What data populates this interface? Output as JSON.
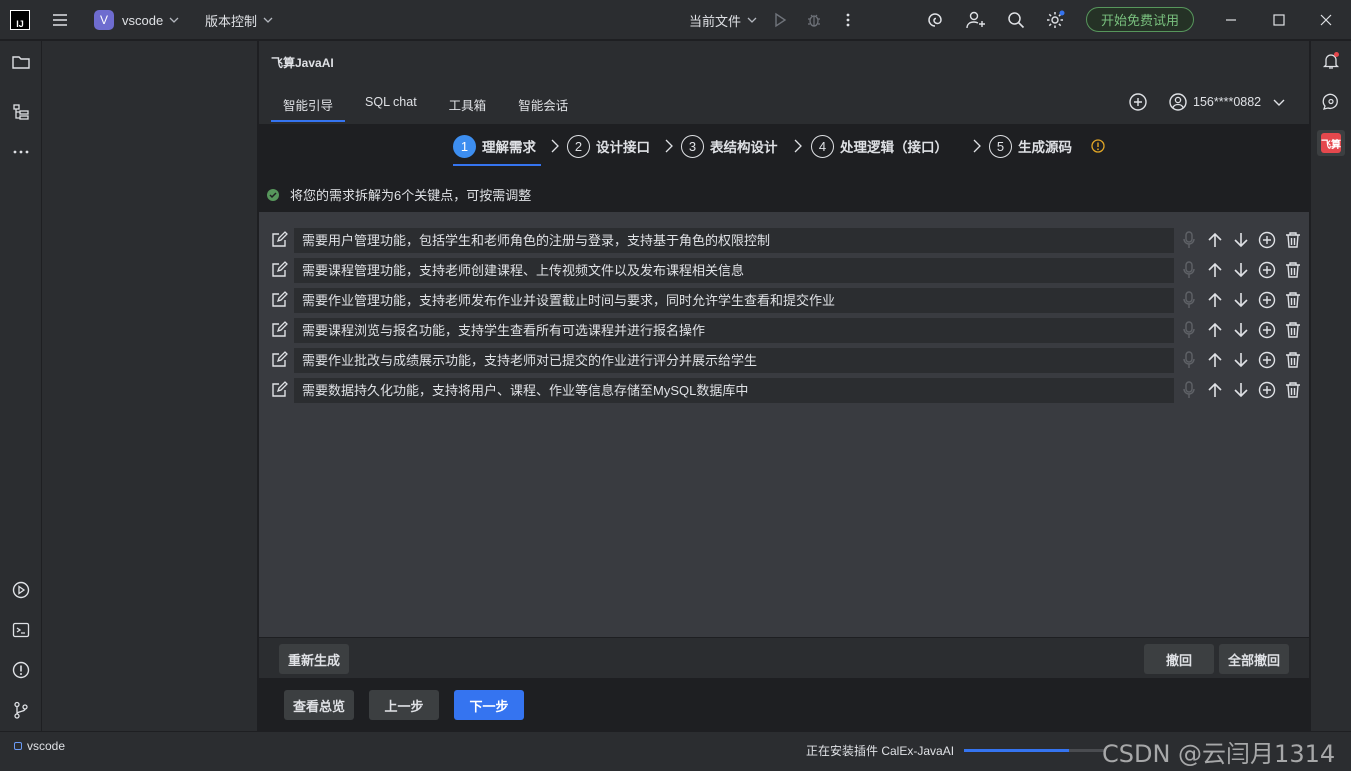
{
  "titlebar": {
    "project_initial": "V",
    "project_name": "vscode",
    "vcs_menu": "版本控制",
    "run_config": "当前文件",
    "trial_button": "开始免费试用",
    "logo_text": "IJ"
  },
  "tool": {
    "title": "飞算JavaAI",
    "tabs": [
      "智能引导",
      "SQL chat",
      "工具箱",
      "智能会话"
    ],
    "active_tab": 0,
    "user": "156****0882"
  },
  "steps": [
    {
      "num": "1",
      "label": "理解需求"
    },
    {
      "num": "2",
      "label": "设计接口"
    },
    {
      "num": "3",
      "label": "表结构设计"
    },
    {
      "num": "4",
      "label": "处理逻辑（接口）"
    },
    {
      "num": "5",
      "label": "生成源码"
    }
  ],
  "info_message": "将您的需求拆解为6个关键点，可按需调整",
  "requirements": [
    "需要用户管理功能，包括学生和老师角色的注册与登录，支持基于角色的权限控制",
    "需要课程管理功能，支持老师创建课程、上传视频文件以及发布课程相关信息",
    "需要作业管理功能，支持老师发布作业并设置截止时间与要求，同时允许学生查看和提交作业",
    "需要课程浏览与报名功能，支持学生查看所有可选课程并进行报名操作",
    "需要作业批改与成绩展示功能，支持老师对已提交的作业进行评分并展示给学生",
    "需要数据持久化功能，支持将用户、课程、作业等信息存储至MySQL数据库中"
  ],
  "buttons": {
    "regenerate": "重新生成",
    "undo": "撤回",
    "undo_all": "全部撤回",
    "overview": "查看总览",
    "prev": "上一步",
    "next": "下一步"
  },
  "status": {
    "project": "vscode",
    "installing": "正在安装插件 CalEx-JavaAI",
    "progress": 0.75,
    "watermark": "CSDN @云闫月1314"
  },
  "right_badge": "飞算",
  "colors": {
    "accent": "#3574f0",
    "success": "#57965c",
    "badge": "#e5484d"
  }
}
